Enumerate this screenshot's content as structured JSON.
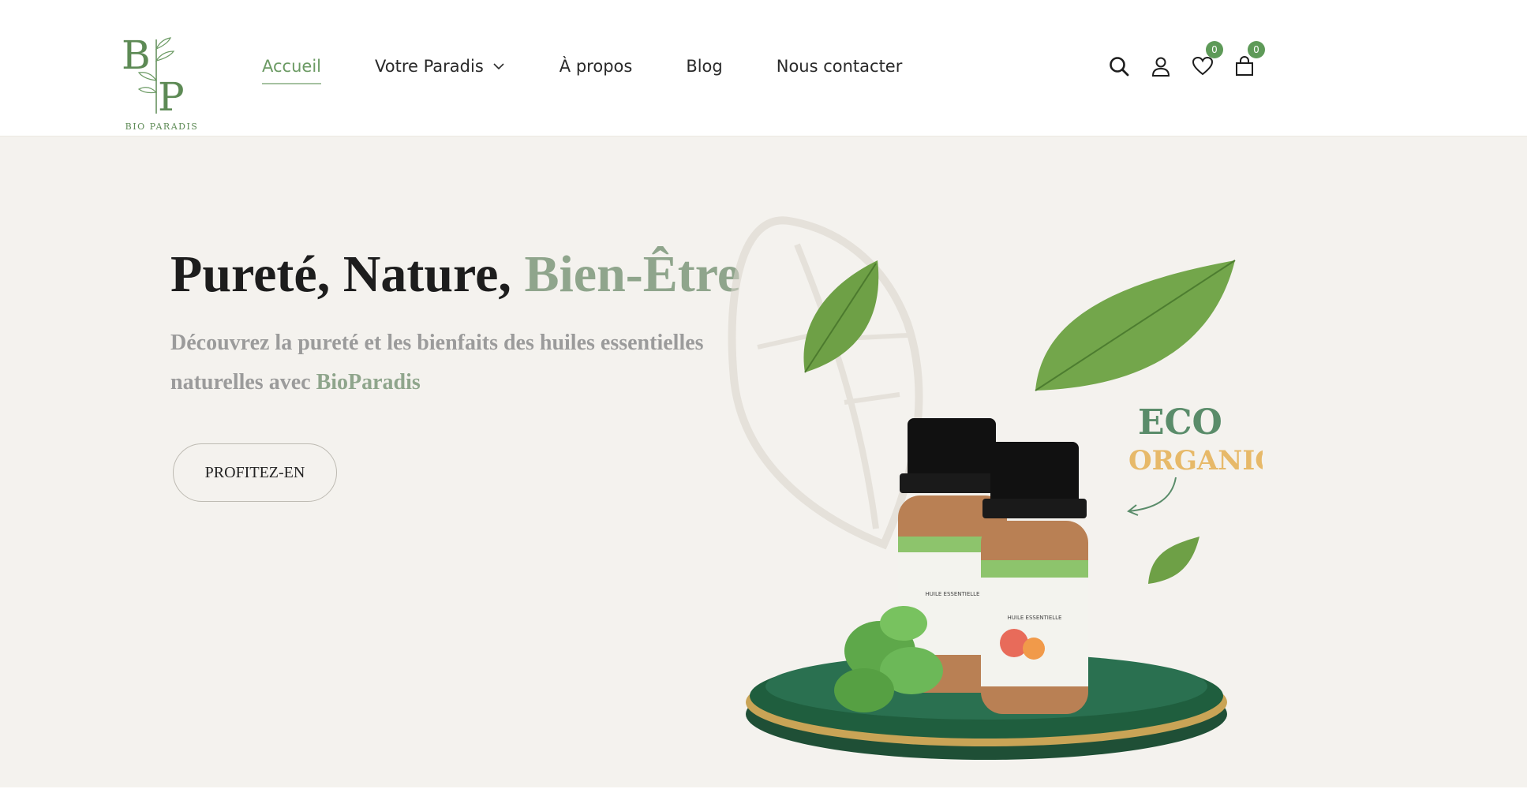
{
  "logo": {
    "text": "BIO PARADIS",
    "letters": "BP"
  },
  "nav": {
    "items": [
      {
        "label": "Accueil",
        "active": true
      },
      {
        "label": "Votre Paradis",
        "dropdown": true
      },
      {
        "label": "À propos"
      },
      {
        "label": "Blog"
      },
      {
        "label": "Nous contacter"
      }
    ]
  },
  "header_icons": {
    "search": "search-icon",
    "account": "user-icon",
    "wishlist": {
      "icon": "heart-icon",
      "count": "0"
    },
    "cart": {
      "icon": "bag-icon",
      "count": "0"
    }
  },
  "hero": {
    "title_main": "Pureté, Nature, ",
    "title_accent": "Bien-Être",
    "subtitle_main": "Découvrez la pureté et les bienfaits des huiles essentielles naturelles avec ",
    "subtitle_brand": "BioParadis",
    "cta_label": "PROFITEZ-EN",
    "badge_line1": "ECO",
    "badge_line2": "ORGANIC",
    "bottle_label1": "HUILE ESSENTIELLE",
    "bottle_label2": "HUILE ESSENTIELLE"
  },
  "colors": {
    "accent": "#6b9a63",
    "accent_soft": "#8fa58c",
    "badge": "#5e9a58",
    "background": "#f4f2ee"
  }
}
